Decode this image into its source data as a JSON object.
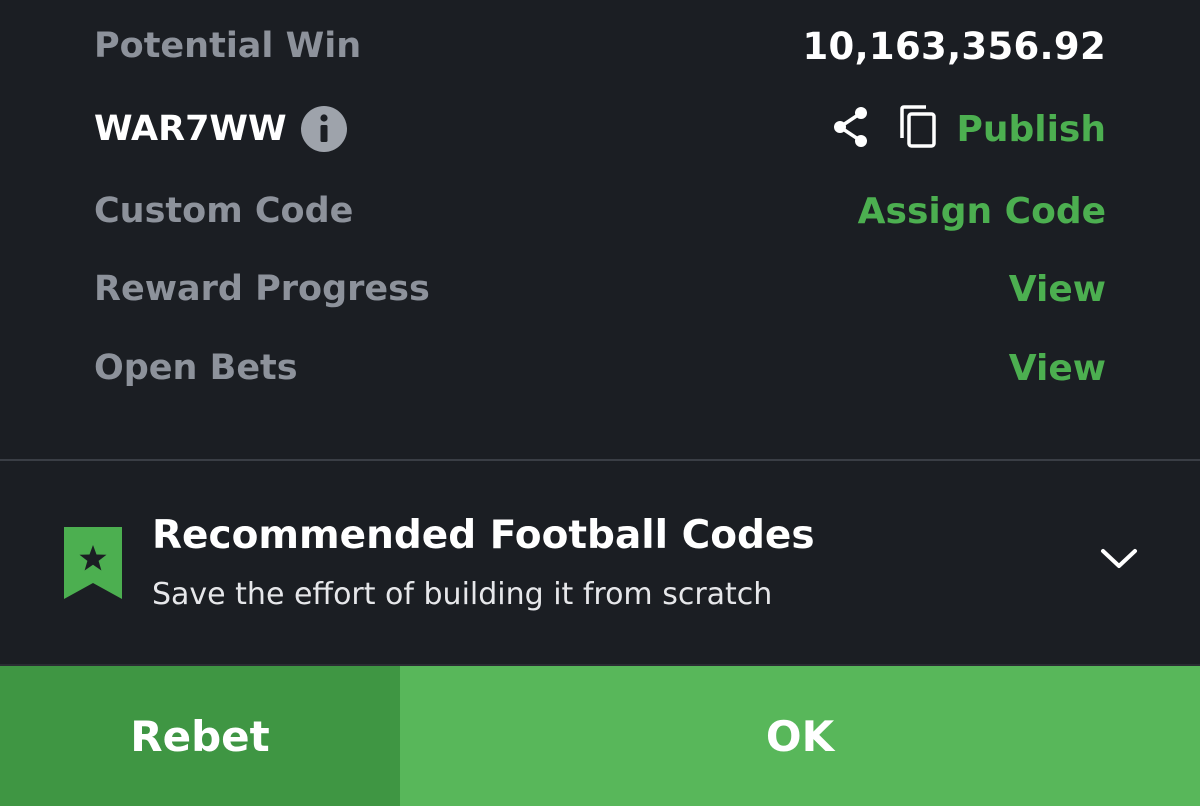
{
  "summary": {
    "potential_win_label": "Potential Win",
    "potential_win_value": "10,163,356.92",
    "booking_code": "WAR7WW",
    "info_icon": "info-icon",
    "share_icon": "share-icon",
    "copy_icon": "copy-icon",
    "publish_label": "Publish",
    "custom_code_label": "Custom Code",
    "assign_code_label": "Assign Code",
    "reward_progress_label": "Reward Progress",
    "reward_progress_action": "View",
    "open_bets_label": "Open Bets",
    "open_bets_action": "View"
  },
  "recommended": {
    "icon": "bookmark-star-icon",
    "title": "Recommended Football Codes",
    "subtitle": "Save the effort of building it from scratch",
    "chevron_icon": "chevron-down-icon"
  },
  "actions": {
    "rebet_label": "Rebet",
    "ok_label": "OK"
  },
  "colors": {
    "background": "#1b1e23",
    "accent_green": "#4caf50",
    "rebet_green": "#3f9643",
    "ok_green": "#58b75a",
    "muted_text": "#8d929b"
  }
}
